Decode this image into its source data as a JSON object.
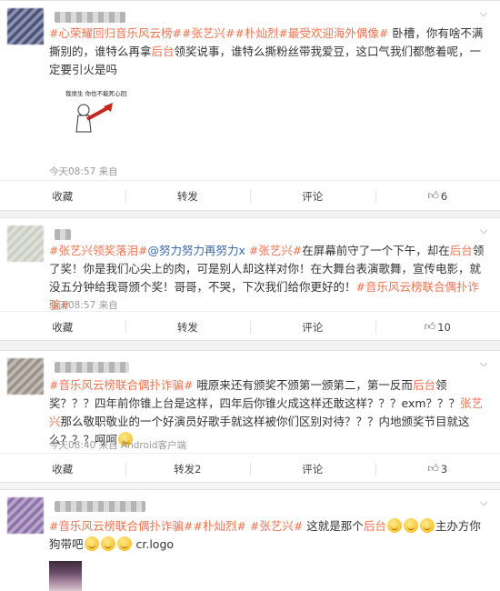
{
  "posts": [
    {
      "segments": [
        {
          "t": "tag",
          "v": "#心荣耀回归音乐风云榜"
        },
        {
          "t": "tag",
          "v": "##张艺兴"
        },
        {
          "t": "tag",
          "v": "##朴灿烈"
        },
        {
          "t": "tag",
          "v": "#最受欢迎海外偶像#"
        },
        {
          "t": "text",
          "v": " 卧槽，你有啥不满撕别的，谁特么再拿"
        },
        {
          "t": "tag",
          "v": "后台"
        },
        {
          "t": "text",
          "v": "领奖说事，谁特么撕粉丝带我爱豆，这口气我们都憋着呢，一定要引火是吗"
        }
      ],
      "sticker_text": "我很生 你也不能死心回来",
      "meta": "今天08:57 来自",
      "actions": {
        "collect": "收藏",
        "repost": "转发",
        "comment": "评论",
        "like": "6"
      }
    },
    {
      "segments": [
        {
          "t": "tag",
          "v": "#张艺兴领奖落泪#"
        },
        {
          "t": "link",
          "v": "@努力努力再努力x"
        },
        {
          "t": "tag",
          "v": " #张艺兴#"
        },
        {
          "t": "text",
          "v": "在屏幕前守了一个下午，却在"
        },
        {
          "t": "tag",
          "v": "后台"
        },
        {
          "t": "text",
          "v": "领了奖！你是我们心尖上的肉，可是别人却这样对你！在大舞台表演歌舞，宣传电影，就没五分钟给我哥颁个奖！哥哥，不哭，下次我们给你更好的！"
        },
        {
          "t": "tag",
          "v": "#音乐风云榜联合偶扑诈骗#"
        }
      ],
      "meta": "今天08:57 来自",
      "actions": {
        "collect": "收藏",
        "repost": "转发",
        "comment": "评论",
        "like": "10"
      }
    },
    {
      "segments": [
        {
          "t": "tag",
          "v": "#音乐风云榜联合偶扑诈骗#"
        },
        {
          "t": "text",
          "v": " 哦原来还有颁奖不颁第一颁第二，第一反而"
        },
        {
          "t": "tag",
          "v": "后台"
        },
        {
          "t": "text",
          "v": "领奖？？？四年前你锥上台是这样，四年后你锥火成这样还敢这样？？？exm？？？"
        },
        {
          "t": "tag",
          "v": "张艺兴"
        },
        {
          "t": "text",
          "v": "那么敬职敬业的一个好演员好歌手就这样被你们区别对待？？？内地颁奖节目就这么？？？呵呵"
        },
        {
          "t": "emoji",
          "v": "smile"
        }
      ],
      "meta": "今天08:40 来自 Android客户端",
      "actions": {
        "collect": "收藏",
        "repost": "转发2",
        "comment": "评论",
        "like": "3"
      }
    },
    {
      "segments": [
        {
          "t": "tag",
          "v": "#音乐风云榜联合偶扑诈骗#"
        },
        {
          "t": "tag",
          "v": "#朴灿烈#"
        },
        {
          "t": "tag",
          "v": " #张艺兴#"
        },
        {
          "t": "text",
          "v": " 这就是那个"
        },
        {
          "t": "tag",
          "v": "后台"
        },
        {
          "t": "emoji",
          "v": "smile"
        },
        {
          "t": "emoji",
          "v": "smile"
        },
        {
          "t": "emoji",
          "v": "smile"
        },
        {
          "t": "text",
          "v": "主办方你狗带吧"
        },
        {
          "t": "emoji",
          "v": "smile"
        },
        {
          "t": "emoji",
          "v": "smile"
        },
        {
          "t": "emoji",
          "v": "smile"
        },
        {
          "t": "text",
          "v": " cr.logo"
        }
      ]
    }
  ],
  "icons": {
    "chevron": "chevron-down-icon",
    "like": "thumbs-up-icon",
    "emoji": "smile-emoji-icon"
  },
  "colors": {
    "tag": "#eb7350",
    "link": "#3b6aa8",
    "meta": "#999999",
    "background": "#f3f3f3"
  }
}
